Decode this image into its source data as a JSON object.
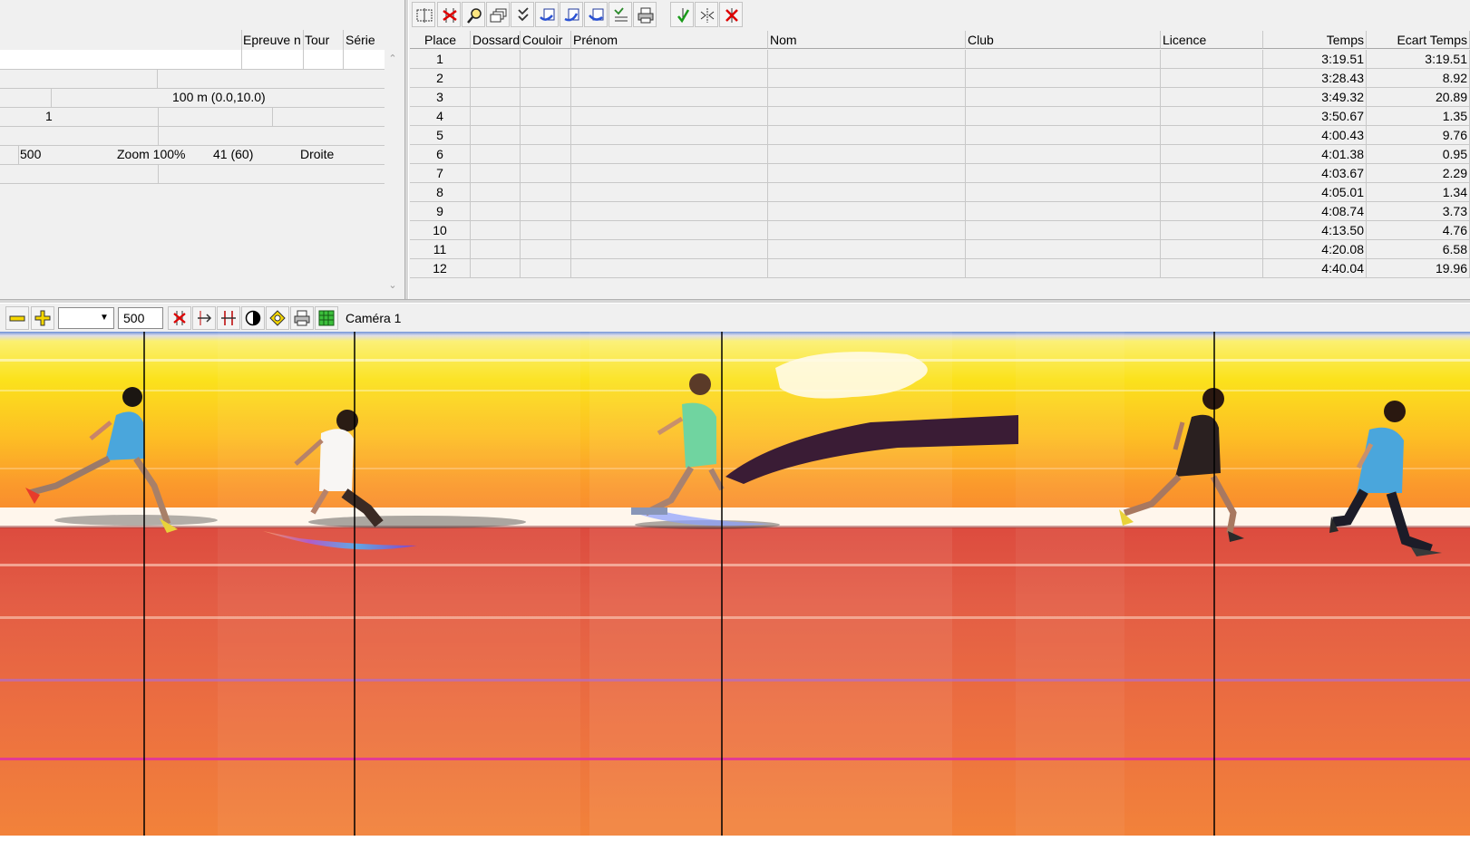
{
  "left_panel": {
    "headers": [
      "Epreuve n",
      "Tour",
      "Série"
    ],
    "distance": "100 m (0.0,10.0)",
    "lane": "1",
    "speed": "500",
    "zoom": "Zoom 100%",
    "frames": "41  (60)",
    "direction": "Droite"
  },
  "top_toolbar": {
    "icons": [
      "grid-detect-icon",
      "delete-marker-icon",
      "search-icon",
      "copy-windows-icon",
      "checklist-icon",
      "import-icon",
      "export-icon",
      "transfer-icon",
      "sort-list-icon",
      "print-icon",
      "validate-icon",
      "center-icon",
      "cancel-icon"
    ]
  },
  "results": {
    "columns": [
      "Place",
      "Dossard",
      "Couloir",
      "Prénom",
      "Nom",
      "Club",
      "Licence",
      "Temps",
      "Ecart Temps"
    ],
    "rows": [
      {
        "place": "1",
        "temps": "3:19.51",
        "ecart": "3:19.51"
      },
      {
        "place": "2",
        "temps": "3:28.43",
        "ecart": "8.92"
      },
      {
        "place": "3",
        "temps": "3:49.32",
        "ecart": "20.89"
      },
      {
        "place": "4",
        "temps": "3:50.67",
        "ecart": "1.35"
      },
      {
        "place": "5",
        "temps": "4:00.43",
        "ecart": "9.76"
      },
      {
        "place": "6",
        "temps": "4:01.38",
        "ecart": "0.95"
      },
      {
        "place": "7",
        "temps": "4:03.67",
        "ecart": "2.29"
      },
      {
        "place": "8",
        "temps": "4:05.01",
        "ecart": "1.34"
      },
      {
        "place": "9",
        "temps": "4:08.74",
        "ecart": "3.73"
      },
      {
        "place": "10",
        "temps": "4:13.50",
        "ecart": "4.76"
      },
      {
        "place": "11",
        "temps": "4:20.08",
        "ecart": "6.58"
      },
      {
        "place": "12",
        "temps": "4:40.04",
        "ecart": "19.96"
      }
    ]
  },
  "bottom_toolbar": {
    "zoom_value": "",
    "speed_value": "500",
    "camera_label": "Caméra 1",
    "icons": [
      "zoom-out-icon",
      "zoom-in-icon",
      "delete-line-icon",
      "swap-icon",
      "split-icon",
      "contrast-icon",
      "brightness-icon",
      "print-icon",
      "grid-icon"
    ]
  },
  "colors": {
    "grid_line": "#c8c8c8",
    "photo_sky": "#fbe21c",
    "photo_track": "#e35d45",
    "marker_line": "#000000"
  }
}
